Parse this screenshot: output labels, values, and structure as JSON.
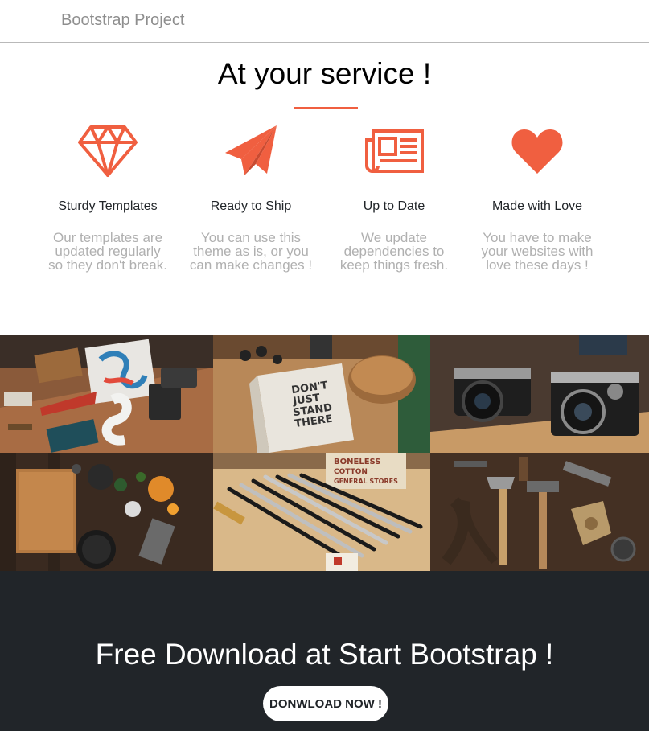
{
  "navbar": {
    "brand": "Bootstrap Project"
  },
  "services": {
    "title": "At your service !",
    "items": [
      {
        "icon": "diamond-icon",
        "name": "Sturdy Templates",
        "line1": "Our templates are",
        "line2": "updated regularly",
        "line3": "so they don't break."
      },
      {
        "icon": "paper-plane-icon",
        "name": "Ready to Ship",
        "line1": "You can use this",
        "line2": "theme as is, or you",
        "line3": "can make changes !"
      },
      {
        "icon": "newspaper-icon",
        "name": "Up to Date",
        "line1": "We update",
        "line2": "dependencies to",
        "line3": "keep things fresh."
      },
      {
        "icon": "heart-icon",
        "name": "Made with Love",
        "line1": "You have to make",
        "line2": "your websites with",
        "line3": "love these days !"
      }
    ]
  },
  "portfolio": {
    "tiles": [
      {
        "image": "stationery-flatlay-image"
      },
      {
        "image": "dont-just-stand-there-book-image",
        "text": "DON'T JUST STAND THERE"
      },
      {
        "image": "vintage-cameras-image"
      },
      {
        "image": "kitchen-table-image"
      },
      {
        "image": "paintbrushes-image",
        "text": "BONELESS COTTON GENERAL STORES"
      },
      {
        "image": "tools-flatlay-image"
      }
    ]
  },
  "download": {
    "title": "Free Download at Start Bootstrap !",
    "button": "DONWLOAD NOW !"
  },
  "colors": {
    "accent": "#f05f40",
    "dark": "#212529",
    "muted": "#b0b0b0"
  }
}
